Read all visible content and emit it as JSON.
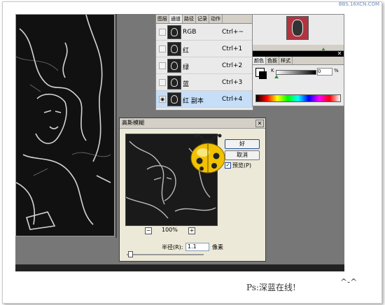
{
  "watermark": "BBS.16XCN.COM",
  "channels_panel": {
    "tabs": [
      "图层",
      "通道",
      "路径",
      "记录",
      "动作"
    ],
    "active_tab": 1,
    "rows": [
      {
        "name": "RGB",
        "shortcut": "Ctrl+~",
        "visible": false,
        "selected": false
      },
      {
        "name": "红",
        "shortcut": "Ctrl+1",
        "visible": false,
        "selected": false
      },
      {
        "name": "绿",
        "shortcut": "Ctrl+2",
        "visible": false,
        "selected": false
      },
      {
        "name": "蓝",
        "shortcut": "Ctrl+3",
        "visible": false,
        "selected": false
      },
      {
        "name": "红 副本",
        "shortcut": "Ctrl+4",
        "visible": true,
        "selected": true
      }
    ]
  },
  "color_panel": {
    "tabs": [
      "颜色",
      "色板",
      "样式"
    ],
    "active_tab": 0,
    "channel_label": "K",
    "value": "0",
    "unit": "%",
    "foreground": "#ffffff",
    "background": "#000000"
  },
  "dialog": {
    "title": "高斯模糊",
    "ok_label": "好",
    "cancel_label": "取消",
    "preview_label": "预览(P)",
    "preview_checked": true,
    "zoom": "100%",
    "zoom_out_icon": "minus-icon",
    "zoom_in_icon": "plus-icon",
    "radius_label": "半径(R):",
    "radius_value": "1.1",
    "radius_unit": "像素"
  },
  "caption": "Ps:深蓝在线!",
  "caption_emoticon": "^-^",
  "colors": {
    "workspace": "#777777",
    "selection": "#c6def7",
    "ladybug": "#f2c200"
  }
}
